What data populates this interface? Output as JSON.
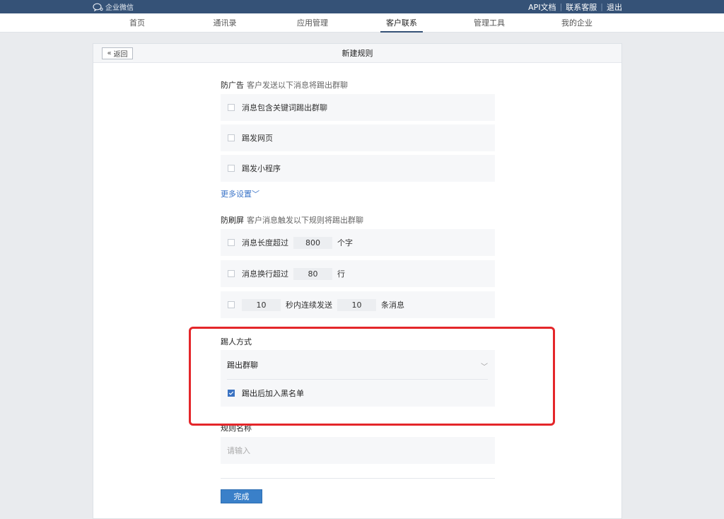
{
  "topbar": {
    "logo_text": "企业微信",
    "links": [
      "API文档",
      "联系客服",
      "退出"
    ]
  },
  "nav": {
    "items": [
      "首页",
      "通讯录",
      "应用管理",
      "客户联系",
      "管理工具",
      "我的企业"
    ],
    "active_index": 3
  },
  "header": {
    "back_label": "返回",
    "title": "新建规则"
  },
  "anti_ad": {
    "title": "防广告",
    "hint": "客户发送以下消息将踢出群聊",
    "options": [
      "消息包含关键词踢出群聊",
      "踢发网页",
      "踢发小程序"
    ],
    "more_label": "更多设置"
  },
  "anti_spam": {
    "title": "防刷屏",
    "hint": "客户消息触发以下规则将踢出群聊",
    "length": {
      "label": "消息长度超过",
      "value": "800",
      "unit": "个字"
    },
    "lines": {
      "label": "消息换行超过",
      "value": "80",
      "unit": "行"
    },
    "burst": {
      "seconds": "10",
      "middle": "秒内连续发送",
      "count": "10",
      "unit": "条消息"
    }
  },
  "kick": {
    "title": "踢人方式",
    "selected": "踢出群聊",
    "blacklist_label": "踢出后加入黑名单",
    "blacklist_checked": true
  },
  "rule_name": {
    "title": "规则名称",
    "placeholder": "请输入"
  },
  "footer": {
    "done_label": "完成"
  },
  "colors": {
    "topbar": "#355277",
    "accent": "#3a80c9",
    "highlight": "#e4262a"
  }
}
